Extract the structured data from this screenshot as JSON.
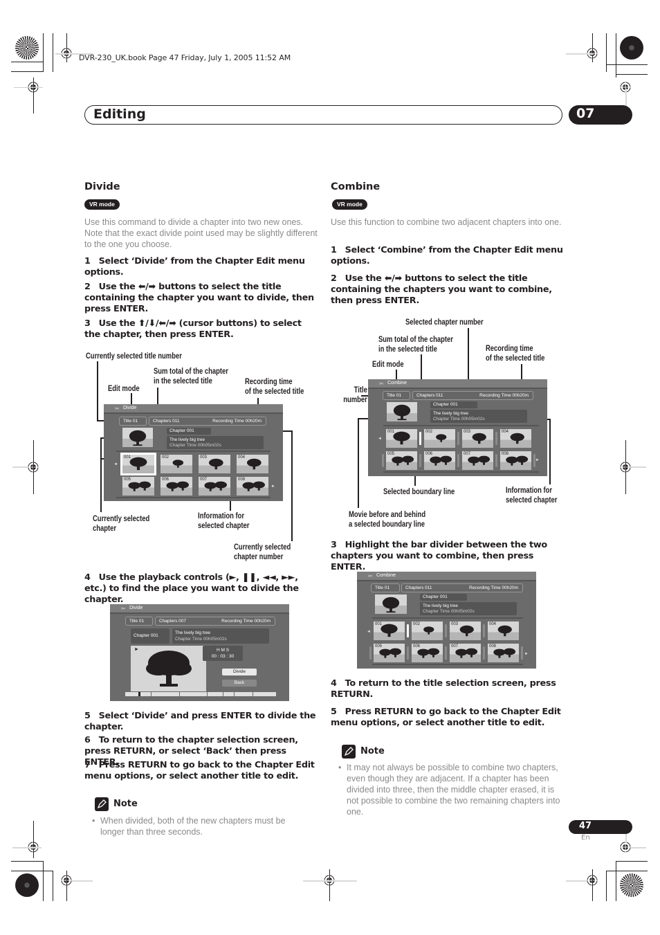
{
  "header": {
    "print_info": "DVR-230_UK.book  Page 47  Friday, July 1, 2005  11:52 AM",
    "section_title": "Editing",
    "chapter_number": "07"
  },
  "divide": {
    "heading": "Divide",
    "badge": "VR mode",
    "intro": "Use this command to divide a chapter into two new ones. Note that the exact divide point used may be slightly different to the one you choose.",
    "steps": [
      {
        "num": "1",
        "text": "Select ‘Divide’ from the Chapter Edit menu options."
      },
      {
        "num": "2",
        "text": "Use the ⬅/➡ buttons to select the title containing the chapter you want to divide, then press ENTER."
      },
      {
        "num": "3",
        "text": "Use the ⬆/⬇/⬅/➡ (cursor buttons) to select the chapter, then press ENTER."
      },
      {
        "num": "4",
        "text": "Use the playback controls (►, ❚❚, ◄◄, ►►, etc.) to find the place you want to divide the chapter."
      },
      {
        "num": "5",
        "text": "Select ‘Divide’ and press ENTER to divide the chapter."
      },
      {
        "num": "6",
        "text": "To return to the chapter selection screen, press RETURN, or select ‘Back’ then press ENTER."
      },
      {
        "num": "7",
        "text": "Press RETURN to go back to the Chapter Edit menu options, or select another title to edit."
      }
    ],
    "callouts": {
      "title_number": "Currently selected title number",
      "sum_total": [
        "Sum total of the chapter",
        "in the selected title"
      ],
      "edit_mode": "Edit mode",
      "recording_time": [
        "Recording time",
        "of the selected title"
      ],
      "selected_chapter": [
        "Currently selected",
        "chapter"
      ],
      "info": [
        "Information for",
        "selected chapter"
      ],
      "chapter_number": [
        "Currently selected",
        "chapter number"
      ]
    },
    "screen1": {
      "mode": "Divide",
      "title": "Title 01",
      "chapters": "Chapters 011",
      "recording_time": "Recording Time  00h20m",
      "chapter": "Chapter 001",
      "chapter_name": "The lively big tree",
      "chapter_time": "Chapter Time  00h05m02s",
      "thumbs": [
        "001",
        "002",
        "003",
        "004",
        "005",
        "006",
        "007",
        "008"
      ]
    },
    "screen2": {
      "mode": "Divide",
      "title": "Title 01",
      "chapters": "Chapters 007",
      "recording_time": "Recording Time  00h20m",
      "chapter": "Chapter 001",
      "chapter_name": "The lively big tree",
      "chapter_time": "Chapter Time  00h05m02s",
      "time_header": "H   M   S",
      "time_value": "00 : 03 : 30",
      "divide_button": "Divide",
      "back_button": "Back",
      "play_icon": "►"
    },
    "note": {
      "heading": "Note",
      "items": [
        "When divided, both of the new chapters must be longer than three seconds."
      ]
    }
  },
  "combine": {
    "heading": "Combine",
    "badge": "VR mode",
    "intro": "Use this function to combine two adjacent chapters into one.",
    "steps": [
      {
        "num": "1",
        "text": "Select ‘Combine’ from the Chapter Edit menu options."
      },
      {
        "num": "2",
        "text": "Use the ⬅/➡ buttons to select the title containing the chapters you want to combine, then press ENTER."
      },
      {
        "num": "3",
        "text": "Highlight the bar divider between the two chapters you want to combine, then press ENTER."
      },
      {
        "num": "4",
        "text": "To return to the title selection screen, press RETURN."
      },
      {
        "num": "5",
        "text": "Press RETURN to go back to the Chapter Edit menu options, or select another title to edit."
      }
    ],
    "callouts": {
      "selected_chapter_number": "Selected chapter number",
      "sum_total": [
        "Sum total of the chapter",
        "in the selected title"
      ],
      "recording_time": [
        "Recording time",
        "of the selected title"
      ],
      "edit_mode": "Edit mode",
      "title_number": [
        "Title",
        "number"
      ],
      "boundary_line": "Selected boundary line",
      "info": [
        "Information for",
        "selected chapter"
      ],
      "movie": [
        "Movie before and behind",
        "a selected boundary line"
      ]
    },
    "screen1": {
      "mode": "Combine",
      "title": "Title 01",
      "chapters": "Chapters 011",
      "recording_time": "Recording Time  00h20m",
      "chapter": "Chapter 001",
      "chapter_name": "The lively big tree",
      "chapter_time": "Chapter Time  00h05m02s",
      "thumbs": [
        "001",
        "002",
        "003",
        "004",
        "005",
        "006",
        "007",
        "008"
      ]
    },
    "screen2": {
      "mode": "Combine",
      "title": "Title 01",
      "chapters": "Chapters 011",
      "recording_time": "Recording Time  00h20m",
      "chapter": "Chapter 001",
      "chapter_name": "The lively big tree",
      "chapter_time": "Chapter Time  00h05m02s",
      "thumbs": [
        "001",
        "002",
        "003",
        "004",
        "005",
        "006",
        "007",
        "008"
      ]
    },
    "note": {
      "heading": "Note",
      "items": [
        "It may not always be possible to combine two chapters, even though they are adjacent. If a chapter has been divided into three, then the middle chapter erased, it is not possible to combine the two remaining chapters into one."
      ]
    }
  },
  "footer": {
    "page_number": "47",
    "language": "En"
  }
}
